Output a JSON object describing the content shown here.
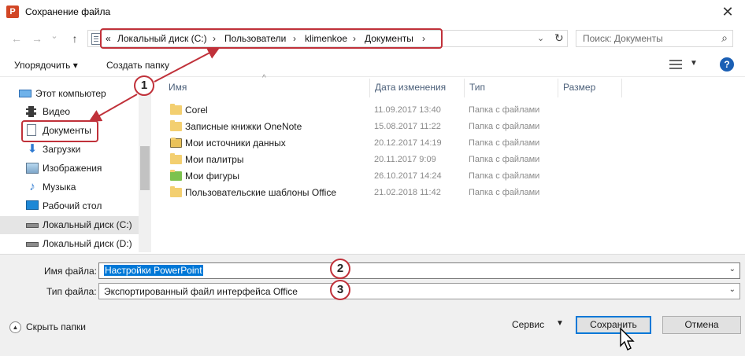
{
  "window": {
    "title": "Сохранение файла",
    "app_icon": "powerpoint-icon",
    "app_icon_letter": "P",
    "close_glyph": "✕"
  },
  "nav": {
    "back_glyph": "←",
    "forward_glyph": "→",
    "history_glyph": "⌄",
    "up_glyph": "↑"
  },
  "address": {
    "overflow": "«",
    "crumbs": [
      "Локальный диск (C:)",
      "Пользователи",
      "klimenkoe",
      "Документы"
    ],
    "separator": "›",
    "dropdown_glyph": "⌄",
    "refresh_glyph": "↻"
  },
  "search": {
    "placeholder": "Поиск: Документы",
    "icon_glyph": "⌕"
  },
  "toolbar": {
    "organize": "Упорядочить ▾",
    "new_folder": "Создать папку",
    "view_dd": "▼",
    "help": "?"
  },
  "sidebar": {
    "items": [
      {
        "label": "Этот компьютер",
        "icon": "computer-icon",
        "selected": false
      },
      {
        "label": "Видео",
        "icon": "video-icon",
        "selected": false
      },
      {
        "label": "Документы",
        "icon": "document-icon",
        "selected": false
      },
      {
        "label": "Загрузки",
        "icon": "download-icon",
        "selected": false
      },
      {
        "label": "Изображения",
        "icon": "pictures-icon",
        "selected": false
      },
      {
        "label": "Музыка",
        "icon": "music-icon",
        "selected": false
      },
      {
        "label": "Рабочий стол",
        "icon": "desktop-icon",
        "selected": false
      },
      {
        "label": "Локальный диск (C:)",
        "icon": "drive-icon",
        "selected": true
      },
      {
        "label": "Локальный диск (D:)",
        "icon": "drive-icon",
        "selected": false
      }
    ]
  },
  "file_list": {
    "columns": [
      "Имя",
      "Дата изменения",
      "Тип",
      "Размер"
    ],
    "sort_glyph": "^",
    "rows": [
      {
        "name": "Corel",
        "date": "11.09.2017 13:40",
        "type": "Папка с файлами",
        "icon": "folder-icon"
      },
      {
        "name": "Записные книжки OneNote",
        "date": "15.08.2017 11:22",
        "type": "Папка с файлами",
        "icon": "folder-icon"
      },
      {
        "name": "Мои источники данных",
        "date": "20.12.2017 14:19",
        "type": "Папка с файлами",
        "icon": "data-folder-icon"
      },
      {
        "name": "Мои палитры",
        "date": "20.11.2017 9:09",
        "type": "Папка с файлами",
        "icon": "folder-icon"
      },
      {
        "name": "Мои фигуры",
        "date": "26.10.2017 14:24",
        "type": "Папка с файлами",
        "icon": "shapes-folder-icon"
      },
      {
        "name": "Пользовательские шаблоны Office",
        "date": "21.02.2018 11:42",
        "type": "Папка с файлами",
        "icon": "folder-icon"
      }
    ]
  },
  "form": {
    "filename_label": "Имя файла:",
    "filename_value": "Настройки PowerPoint",
    "filetype_label": "Тип файла:",
    "filetype_value": "Экспортированный файл интерфейса Office",
    "dd_glyph": "⌄"
  },
  "footer": {
    "hide_folders": "Скрыть папки",
    "hide_folders_glyph": "▲",
    "service": "Сервис",
    "service_dd": "▼",
    "save": "Сохранить",
    "cancel": "Отмена"
  },
  "annotations": {
    "callout_1": "1",
    "callout_2": "2",
    "callout_3": "3",
    "color": "#c0313a"
  },
  "colors": {
    "accent": "#0078d7",
    "selection": "#e5e5e5",
    "folder": "#f3cf70"
  }
}
